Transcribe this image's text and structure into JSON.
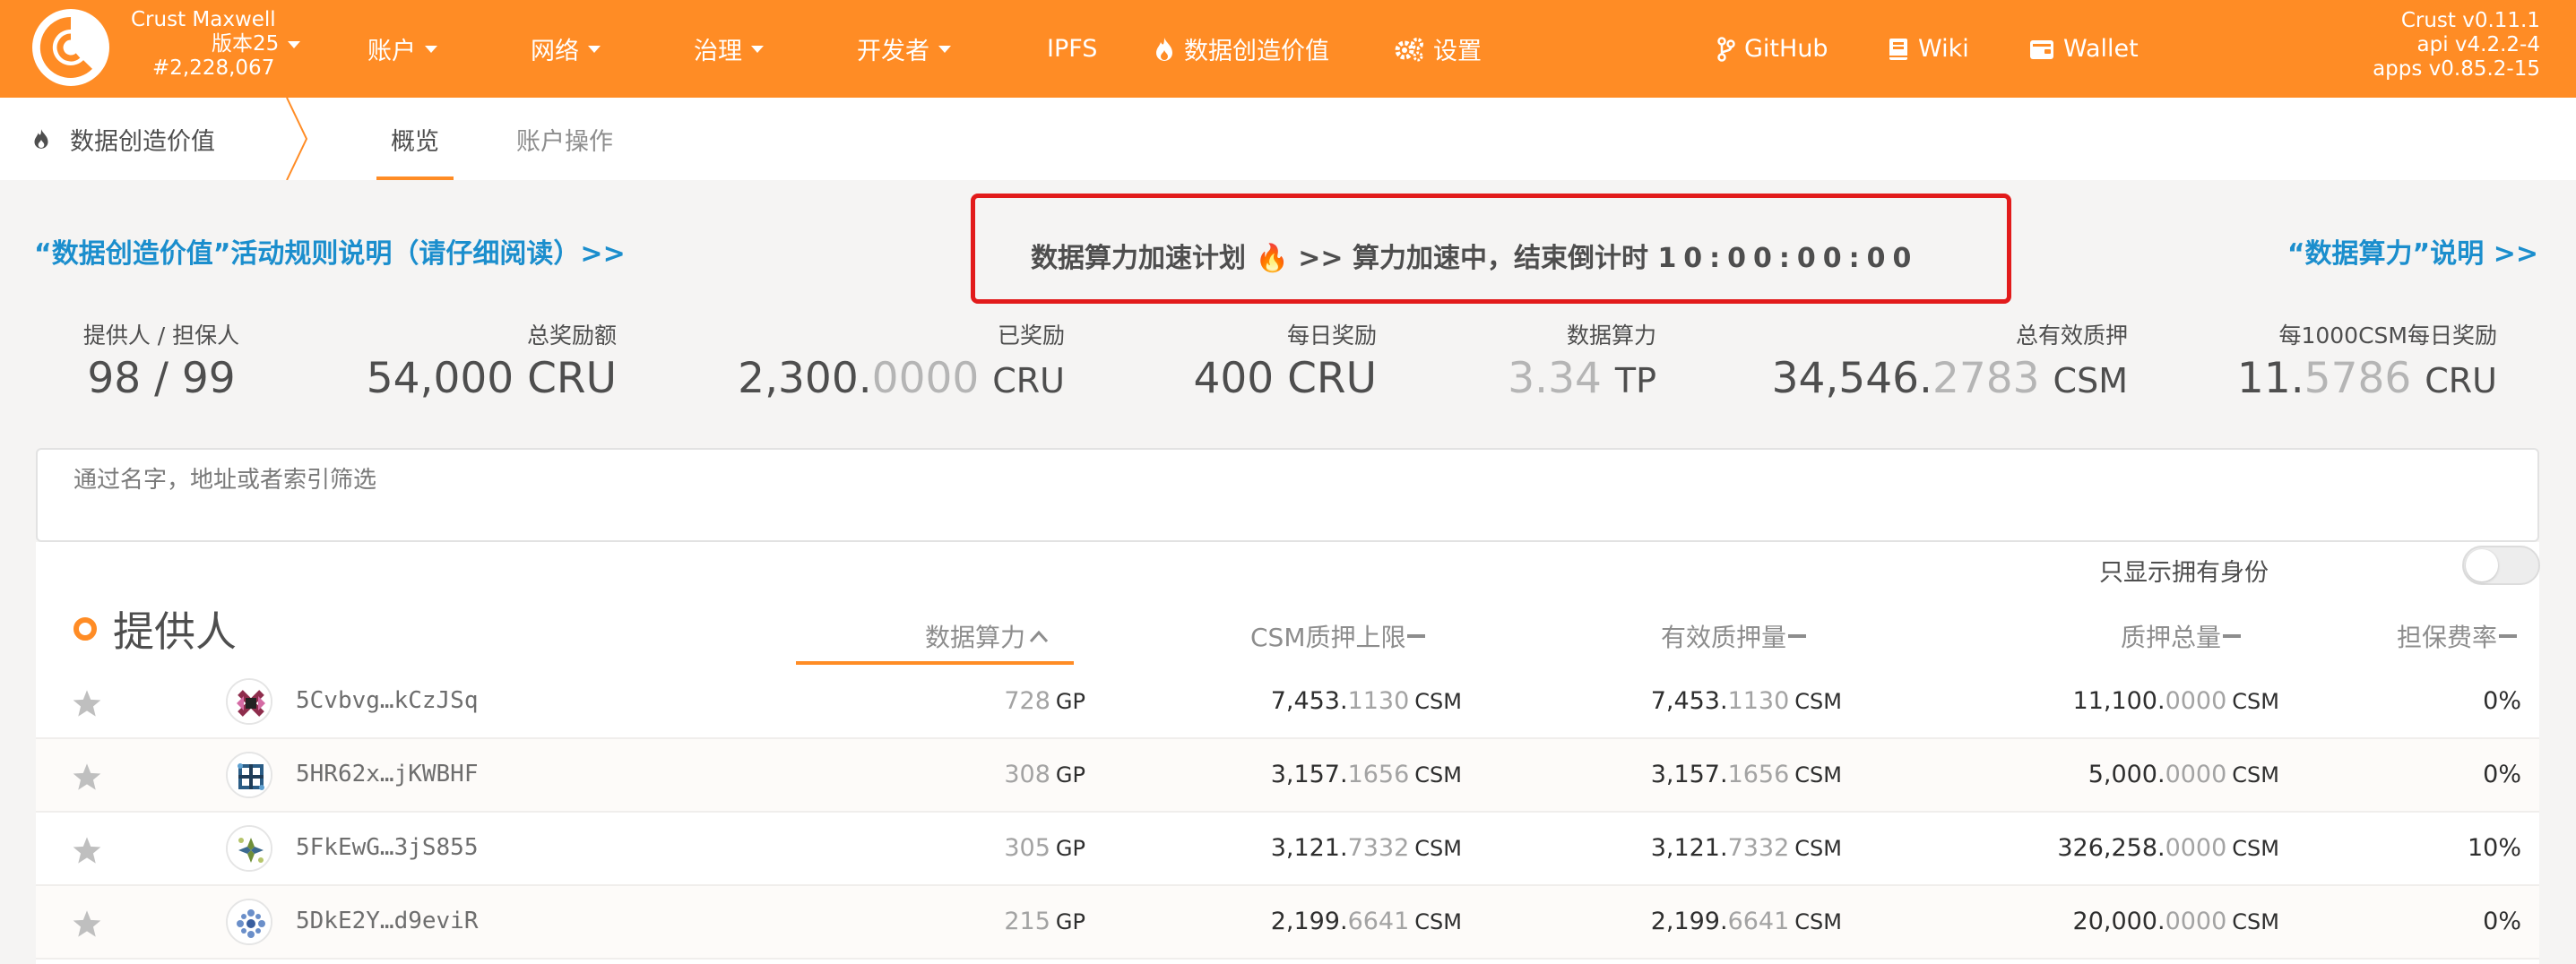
{
  "topbar": {
    "chain_name": "Crust Maxwell",
    "chain_version": "版本25",
    "block_number": "#2,228,067",
    "menu": [
      {
        "label": "账户",
        "caret": true
      },
      {
        "label": "网络",
        "caret": true
      },
      {
        "label": "治理",
        "caret": true
      },
      {
        "label": "开发者",
        "caret": true
      },
      {
        "label": "IPFS"
      },
      {
        "label": "数据创造价值",
        "icon": "fire-icon"
      },
      {
        "label": "设置",
        "icon": "gears-icon"
      }
    ],
    "links": [
      {
        "label": "GitHub",
        "icon": "code-branch-icon"
      },
      {
        "label": "Wiki",
        "icon": "book-icon"
      },
      {
        "label": "Wallet",
        "icon": "wallet-icon"
      }
    ],
    "versions": [
      "Crust v0.11.1",
      "api v4.2.2-4",
      "apps v0.85.2-15"
    ]
  },
  "subnav": {
    "section": "数据创造价值",
    "tabs": [
      {
        "label": "概览",
        "active": true
      },
      {
        "label": "账户操作",
        "active": false
      }
    ]
  },
  "banner": {
    "rules_link": "“数据创造价值”活动规则说明（请仔细阅读）>>",
    "promo_text_a": "数据算力加速计划",
    "promo_emoji": "🔥",
    "promo_text_b": ">> 算力加速中，结束倒计时",
    "countdown": "10:00:00:00",
    "right_link": "“数据算力”说明 >>"
  },
  "stats": [
    {
      "label": "提供人 / 担保人",
      "value": "98 / 99"
    },
    {
      "label": "总奖励额",
      "value": "54,000 CRU"
    },
    {
      "label": "已奖励",
      "value_int": "2,300.",
      "value_dec": "0000",
      "unit": "CRU"
    },
    {
      "label": "每日奖励",
      "value": "400 CRU"
    },
    {
      "label": "数据算力",
      "value_int": "3.34",
      "unit": "TP"
    },
    {
      "label": "总有效质押",
      "value_int": "34,546.",
      "value_dec": "2783",
      "unit": "CSM"
    },
    {
      "label": "每1000CSM每日奖励",
      "value_int": "11.",
      "value_dec": "5786",
      "unit": "CRU"
    }
  ],
  "filter": {
    "placeholder": "通过名字，地址或者索引筛选"
  },
  "toggle": {
    "label": "只显示拥有身份",
    "checked": false
  },
  "table": {
    "title": "提供人",
    "columns": [
      "数据算力",
      "CSM质押上限",
      "有效质押量",
      "质押总量",
      "担保费率"
    ],
    "rows": [
      {
        "address": "5Cvbvg…kCzJSq",
        "power": "728",
        "power_unit": "GP",
        "limit_int": "7,453.",
        "limit_dec": "1130",
        "effective_int": "7,453.",
        "effective_dec": "1130",
        "total_int": "11,100.",
        "total_dec": "0000",
        "fee": "0%",
        "unit": "CSM"
      },
      {
        "address": "5HR62x…jKWBHF",
        "power": "308",
        "power_unit": "GP",
        "limit_int": "3,157.",
        "limit_dec": "1656",
        "effective_int": "3,157.",
        "effective_dec": "1656",
        "total_int": "5,000.",
        "total_dec": "0000",
        "fee": "0%",
        "unit": "CSM"
      },
      {
        "address": "5FkEwG…3jS855",
        "power": "305",
        "power_unit": "GP",
        "limit_int": "3,121.",
        "limit_dec": "7332",
        "effective_int": "3,121.",
        "effective_dec": "7332",
        "total_int": "326,258.",
        "total_dec": "0000",
        "fee": "10%",
        "unit": "CSM"
      },
      {
        "address": "5DkE2Y…d9eviR",
        "power": "215",
        "power_unit": "GP",
        "limit_int": "2,199.",
        "limit_dec": "6641",
        "effective_int": "2,199.",
        "effective_dec": "6641",
        "total_int": "20,000.",
        "total_dec": "0000",
        "fee": "0%",
        "unit": "CSM"
      }
    ]
  },
  "colors": {
    "brand": "#ff8c25",
    "link": "#1b8ecd",
    "highlight_border": "#e21b1b"
  }
}
